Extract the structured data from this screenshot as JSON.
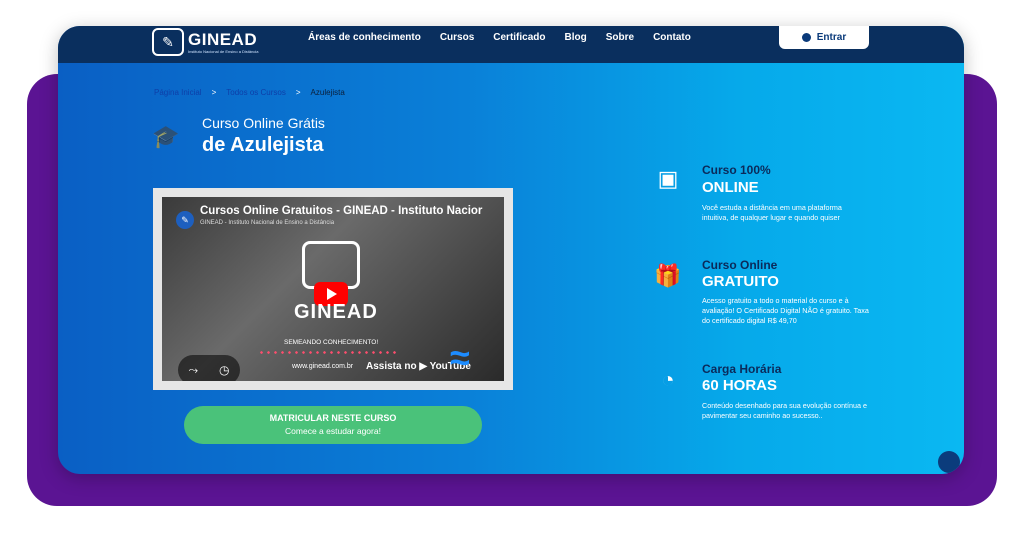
{
  "nav": {
    "logo_text": "GINEAD",
    "logo_sub": "Instituto Nacional de Ensino a Distância",
    "menu": [
      "Áreas de conhecimento",
      "Cursos",
      "Certificado",
      "Blog",
      "Sobre",
      "Contato"
    ],
    "login_label": "Entrar"
  },
  "breadcrumb": {
    "home": "Página Inicial",
    "sep": ">",
    "courses": "Todos os Cursos",
    "current": "Azulejista"
  },
  "course": {
    "title_small": "Curso Online Grátis",
    "title_big": "de Azulejista"
  },
  "video": {
    "title": "Cursos Online Gratuitos - GINEAD - Instituto Nacior",
    "subtitle": "GINEAD - Instituto Nacional de Ensino a Distância",
    "logo_text": "GINEAD",
    "motto": "SEMEANDO CONHECIMENTO!",
    "url": "www.ginead.com.br",
    "assista": "Assista no ▶ YouTube"
  },
  "cta": {
    "line1": "MATRICULAR NESTE CURSO",
    "line2": "Comece a estudar agora!"
  },
  "features": [
    {
      "head1": "Curso 100%",
      "head2": "ONLINE",
      "desc": "Você estuda a distância em uma plataforma intuitiva, de qualquer lugar e quando quiser",
      "icon": "monitor-play-icon"
    },
    {
      "head1": "Curso Online",
      "head2": "GRATUITO",
      "desc": "Acesso gratuito a todo o material do curso e à avaliação! O Certificado Digital NÃO é gratuito. Taxa do certificado digital R$ 49,70",
      "icon": "gift-icon"
    },
    {
      "head1": "Carga Horária",
      "head2": "60 HORAS",
      "desc": "Conteúdo desenhado para sua evolução contínua e pavimentar seu caminho ao sucesso..",
      "icon": "clock-icon"
    }
  ],
  "colors": {
    "nav_bg": "#0a2f5e",
    "purple_frame": "#5b1493",
    "cta_green": "#4ac27a"
  }
}
